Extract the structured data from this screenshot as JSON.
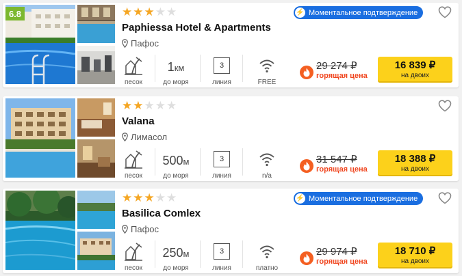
{
  "hotels": [
    {
      "rating": "6.8",
      "stars": 3,
      "max_stars": 5,
      "name": "Paphiessa Hotel & Apartments",
      "city": "Пафос",
      "instant_confirmation": "Моментальное подтверждение",
      "beach_label": "песок",
      "distance_value": "1",
      "distance_unit": "км",
      "distance_label": "до моря",
      "line_value": "3",
      "line_label": "линия",
      "wifi_label": "FREE",
      "old_price": "29 274 ₽",
      "hot_label": "горящая цена",
      "price": "16 839 ₽",
      "price_note": "на двоих"
    },
    {
      "rating": null,
      "stars": 2,
      "max_stars": 5,
      "name": "Valana",
      "city": "Лимасол",
      "instant_confirmation": null,
      "beach_label": "песок",
      "distance_value": "500",
      "distance_unit": "м",
      "distance_label": "до моря",
      "line_value": "3",
      "line_label": "линия",
      "wifi_label": "n/a",
      "old_price": "31 547 ₽",
      "hot_label": "горящая цена",
      "price": "18 388 ₽",
      "price_note": "на двоих"
    },
    {
      "rating": null,
      "stars": 3,
      "max_stars": 5,
      "name": "Basilica Comlex",
      "city": "Пафос",
      "instant_confirmation": "Моментальное подтверждение",
      "beach_label": "песок",
      "distance_value": "250",
      "distance_unit": "м",
      "distance_label": "до моря",
      "line_value": "3",
      "line_label": "линия",
      "wifi_label": "платно",
      "old_price": "29 974 ₽",
      "hot_label": "горящая цена",
      "price": "18 710 ₽",
      "price_note": "на двоих"
    }
  ],
  "colors": {
    "rating_badge": "#7cb82f",
    "star_on": "#f5a623",
    "star_off": "#dedede",
    "instant_badge": "#1a6ee0",
    "hot": "#f0441d",
    "price_button": "#fcd11b"
  },
  "icons": [
    "location-pin-icon",
    "lightning-icon",
    "heart-icon",
    "beach-sand-icon",
    "wifi-icon",
    "fire-icon"
  ]
}
